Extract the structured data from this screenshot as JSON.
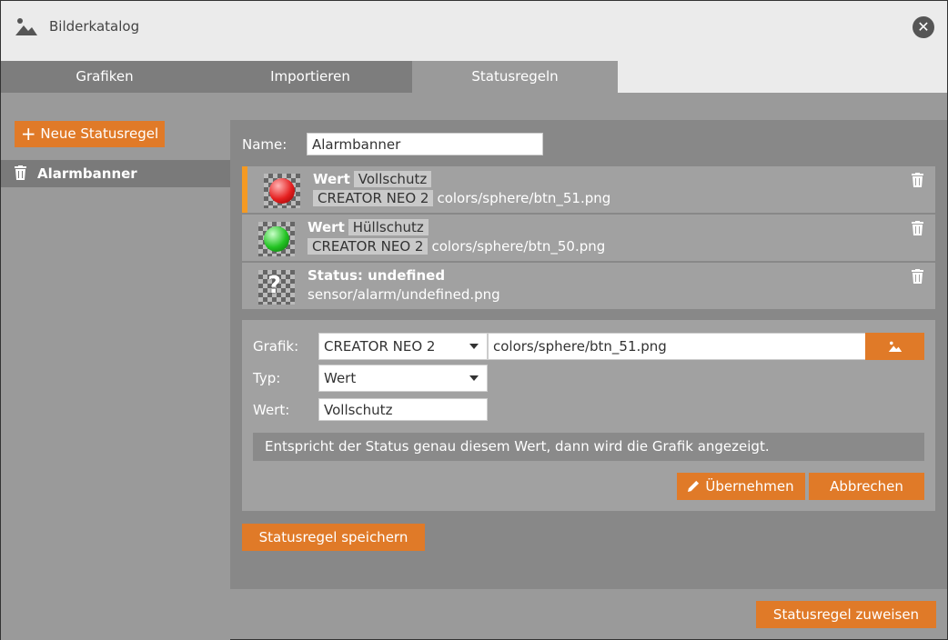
{
  "window": {
    "title": "Bilderkatalog",
    "close_icon": "close-icon"
  },
  "tabs": [
    {
      "label": "Grafiken"
    },
    {
      "label": "Importieren"
    },
    {
      "label": "Statusregeln"
    }
  ],
  "sidebar": {
    "new_rule_label": "Neue Statusregel",
    "items": [
      {
        "label": "Alarmbanner"
      }
    ]
  },
  "main": {
    "name_label": "Name:",
    "name_value": "Alarmbanner",
    "rules": [
      {
        "title": "Wert",
        "badge": "Vollschutz",
        "source": "CREATOR NEO 2",
        "path": "colors/sphere/btn_51.png",
        "sphere_color": "#e52020"
      },
      {
        "title": "Wert",
        "badge": "Hüllschutz",
        "source": "CREATOR NEO 2",
        "path": "colors/sphere/btn_50.png",
        "sphere_color": "#22c322"
      },
      {
        "title": "Status: undefined",
        "path": "sensor/alarm/undefined.png"
      }
    ],
    "editor": {
      "grafik_label": "Grafik:",
      "grafik_source": "CREATOR NEO 2",
      "grafik_path": "colors/sphere/btn_51.png",
      "typ_label": "Typ:",
      "typ_value": "Wert",
      "wert_label": "Wert:",
      "wert_value": "Vollschutz",
      "hint": "Entspricht der Status genau diesem Wert, dann wird die Grafik angezeigt.",
      "apply_label": "Übernehmen",
      "cancel_label": "Abbrechen"
    },
    "save_label": "Statusregel speichern"
  },
  "footer": {
    "assign_label": "Statusregel zuweisen"
  },
  "colors": {
    "accent": "#e07a28",
    "selected_marker": "#f59a23"
  }
}
